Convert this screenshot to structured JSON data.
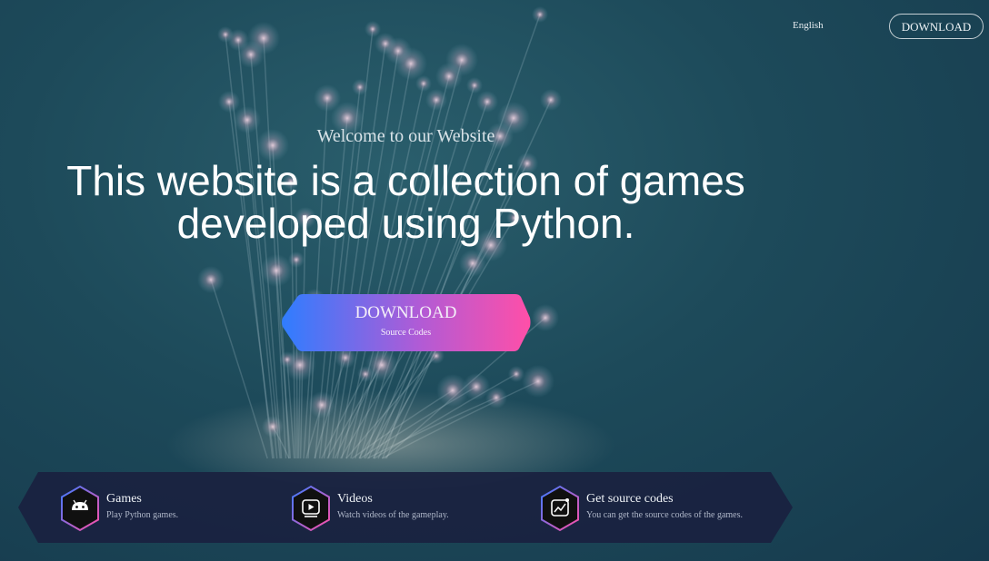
{
  "header": {
    "language_label": "English",
    "download_label": "DOWNLOAD"
  },
  "hero": {
    "welcome": "Welcome to our Website",
    "headline_line1": "This website is a collection of games",
    "headline_line2": "developed using Python.",
    "cta_label": "DOWNLOAD",
    "cta_sublabel": "Source Codes"
  },
  "features": [
    {
      "title": "Games",
      "subtitle": "Play Python games.",
      "icon": "android-icon"
    },
    {
      "title": "Videos",
      "subtitle": "Watch videos of the gameplay.",
      "icon": "play-video-icon"
    },
    {
      "title": "Get source codes",
      "subtitle": "You can get the source codes of the games.",
      "icon": "chart-icon"
    }
  ],
  "colors": {
    "background": "#1d4a5a",
    "cta_gradient_start": "#2f7dff",
    "cta_gradient_end": "#ff4fa8",
    "feature_bar": "#1a2140"
  }
}
